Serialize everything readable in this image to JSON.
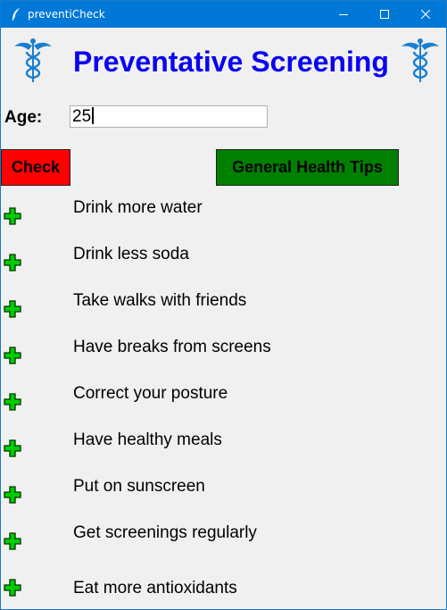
{
  "window": {
    "title": "preventiCheck",
    "title_color": "#ffffff",
    "titlebar_color": "#0078d7"
  },
  "icons": {
    "app": "feather-icon",
    "minimize": "minimize-icon",
    "maximize": "maximize-icon",
    "close": "close-icon",
    "logo": "caduceus-icon",
    "tip": "green-plus-icon"
  },
  "header": {
    "title": "Preventative Screening",
    "title_color": "#0a00f2"
  },
  "form": {
    "age_label": "Age:",
    "age_value": "25"
  },
  "buttons": {
    "check_label": "Check",
    "check_color": "#ff0000",
    "tips_label": "General Health Tips",
    "tips_color": "#008000"
  },
  "tips": [
    "Drink more water",
    "Drink less soda",
    "Take walks with friends",
    "Have breaks from screens",
    "Correct your posture",
    "Have healthy meals",
    "Put on sunscreen",
    "Get screenings regularly",
    "Eat more antioxidants"
  ]
}
